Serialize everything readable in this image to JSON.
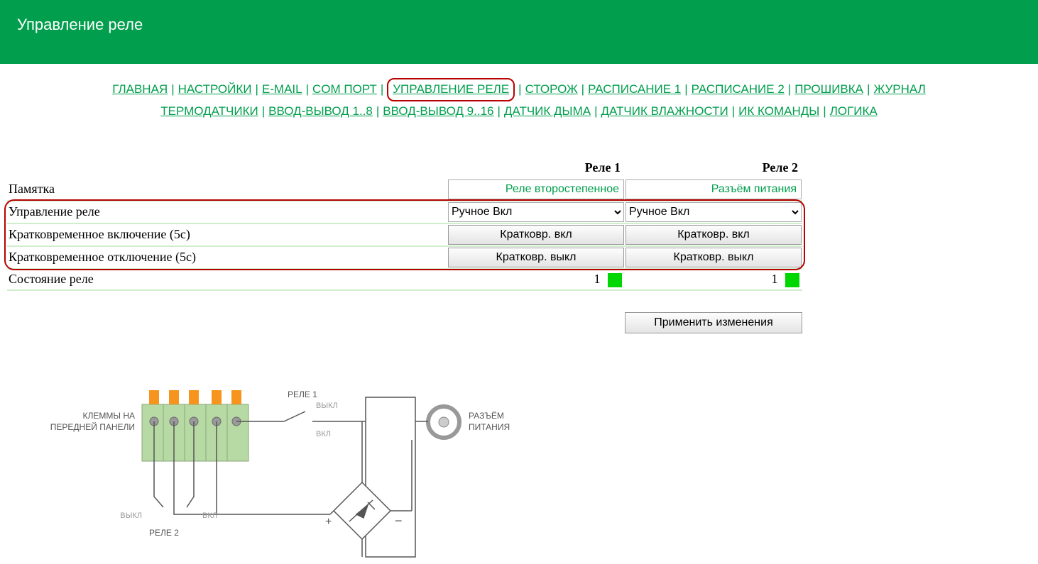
{
  "header": {
    "title": "Управление реле"
  },
  "nav": {
    "row1": [
      "ГЛАВНАЯ",
      "НАСТРОЙКИ",
      "E-MAIL",
      "COM ПОРТ",
      "УПРАВЛЕНИЕ РЕЛЕ",
      "СТОРОЖ",
      "РАСПИСАНИЕ 1",
      "РАСПИСАНИЕ 2",
      "ПРОШИВКА",
      "ЖУРНАЛ"
    ],
    "row2": [
      "ТЕРМОДАТЧИКИ",
      "ВВОД-ВЫВОД 1..8",
      "ВВОД-ВЫВОД 9..16",
      "ДАТЧИК ДЫМА",
      "ДАТЧИК ВЛАЖНОСТИ",
      "ИК КОМАНДЫ",
      "ЛОГИКА"
    ],
    "active": "УПРАВЛЕНИЕ РЕЛЕ"
  },
  "table": {
    "columns": {
      "r1": "Реле 1",
      "r2": "Реле 2"
    },
    "memo": {
      "label": "Памятка",
      "r1": "Реле второстепенное",
      "r2": "Разъём питания"
    },
    "control": {
      "label": "Управление реле",
      "r1": "Ручное Вкл",
      "r2": "Ручное Вкл"
    },
    "short_on": {
      "label": "Кратковременное включение (5с)",
      "btn": "Кратковр.   вкл"
    },
    "short_off": {
      "label": "Кратковременное отключение (5с)",
      "btn": "Кратковр. выкл"
    },
    "state": {
      "label": "Состояние реле",
      "r1": "1",
      "r2": "1"
    }
  },
  "apply": {
    "label": "Применить изменения"
  },
  "schematic": {
    "left_label_1": "КЛЕММЫ НА",
    "left_label_2": "ПЕРЕДНЕЙ ПАНЕЛИ",
    "relay1": "РЕЛЕ 1",
    "relay2": "РЕЛЕ 2",
    "on": "ВКЛ",
    "off": "ВЫКЛ",
    "plus": "+",
    "minus": "−",
    "conn_1": "РАЗЪЁМ",
    "conn_2": "ПИТАНИЯ"
  }
}
